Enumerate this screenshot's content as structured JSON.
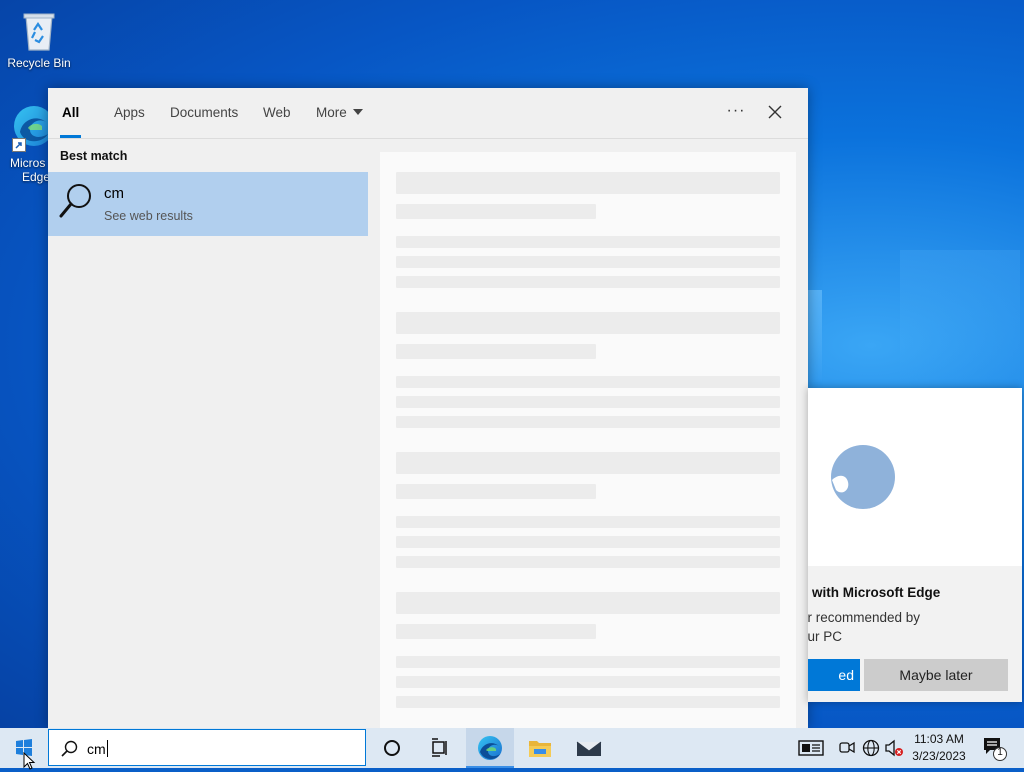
{
  "desktop": {
    "icons": [
      {
        "name": "recycle-bin",
        "label": "Recycle Bin"
      },
      {
        "name": "microsoft-edge",
        "label_line1": "Micros",
        "label_line2": "Edge"
      }
    ]
  },
  "search_panel": {
    "tabs": [
      {
        "label": "All",
        "active": true
      },
      {
        "label": "Apps"
      },
      {
        "label": "Documents"
      },
      {
        "label": "Web"
      },
      {
        "label": "More"
      }
    ],
    "more_options_label": "···",
    "best_match_heading": "Best match",
    "best_match": {
      "title": "cm",
      "subtitle": "See web results",
      "icon": "search-icon"
    }
  },
  "edge_toast": {
    "heading": "b with Microsoft Edge",
    "body_line1": "er recommended by",
    "body_line2": "our PC",
    "primary_button": "ed",
    "secondary_button": "Maybe later"
  },
  "taskbar": {
    "search_value": "cm",
    "clock_time": "11:03 AM",
    "clock_date": "3/23/2023",
    "notification_count": "1"
  },
  "colors": {
    "accent": "#0078d7",
    "selected_result": "#b1cfee",
    "taskbar": "#dde8f3"
  }
}
